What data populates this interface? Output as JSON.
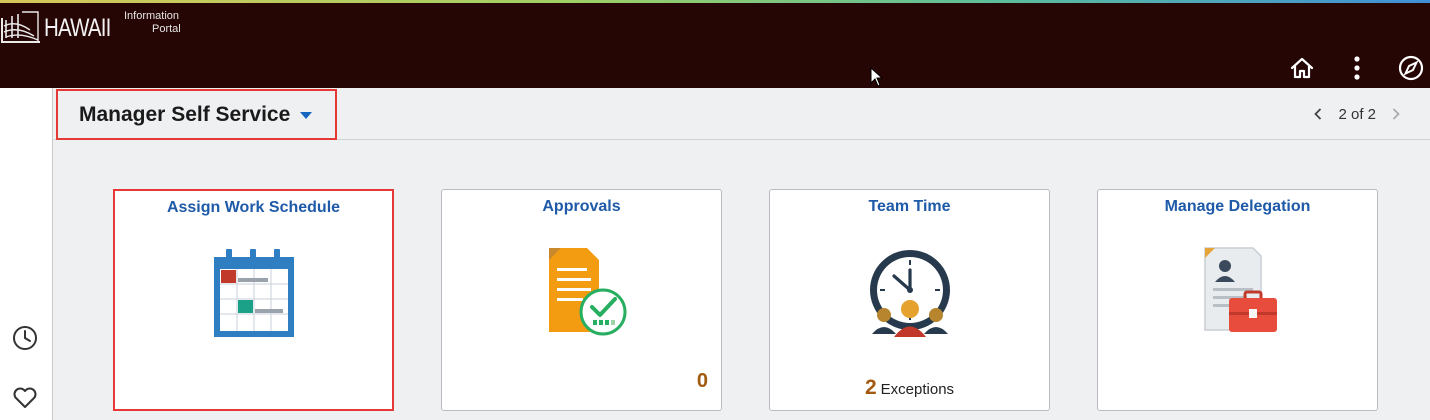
{
  "header": {
    "logo_text": "HAWAII",
    "logo_sub_line1": "Information",
    "logo_sub_line2": "Portal",
    "icons": [
      "home-icon",
      "more-vertical-icon",
      "navbar-compass-icon"
    ],
    "background_color": "#260505"
  },
  "left_rail": {
    "icons": [
      "recent-clock-icon",
      "favorites-heart-icon"
    ]
  },
  "homepage_selector": {
    "label": "Manager Self Service"
  },
  "pager": {
    "text": "2 of 2"
  },
  "tiles": [
    {
      "title": "Assign Work Schedule",
      "icon": "calendar-icon",
      "selected": true
    },
    {
      "title": "Approvals",
      "icon": "approval-document-icon",
      "count": "0"
    },
    {
      "title": "Team Time",
      "icon": "team-clock-icon",
      "count": "2",
      "count_label": "Exceptions"
    },
    {
      "title": "Manage Delegation",
      "icon": "delegation-briefcase-icon"
    }
  ],
  "colors": {
    "accent_blue": "#1e5aa8",
    "highlight_red": "#e53935",
    "count_brown": "#a25a10"
  }
}
